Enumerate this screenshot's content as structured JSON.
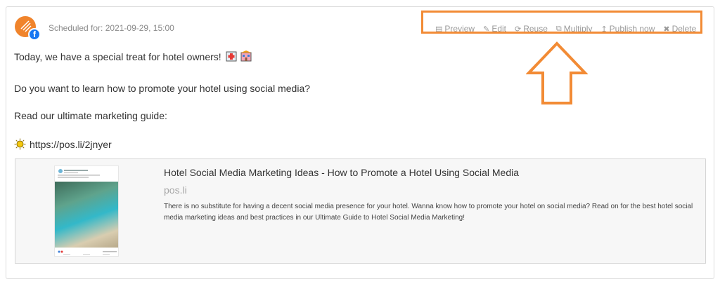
{
  "post": {
    "scheduled_label": "Scheduled for: 2021-09-29, 15:00",
    "lines": [
      "Today, we have a special treat for hotel owners!",
      "Do you want to learn how to promote your hotel using social media?",
      "Read our ultimate marketing guide:",
      "https://pos.li/2jnyer"
    ]
  },
  "toolbar": {
    "preview": "Preview",
    "edit": "Edit",
    "reuse": "Reuse",
    "multiply": "Multiply",
    "publish_now": "Publish now",
    "delete": "Delete"
  },
  "link_preview": {
    "title": "Hotel Social Media Marketing Ideas - How to Promote a Hotel Using Social Media",
    "domain": "pos.li",
    "description": "There is no substitute for having a decent social media presence for your hotel. Wanna know how to promote your hotel on social media? Read on for the best hotel social media marketing ideas and best practices in our Ultimate Guide to Hotel Social Media Marketing!"
  },
  "colors": {
    "accent": "#f28b35",
    "facebook": "#1877f2",
    "muted_text": "#9a9a9a"
  }
}
